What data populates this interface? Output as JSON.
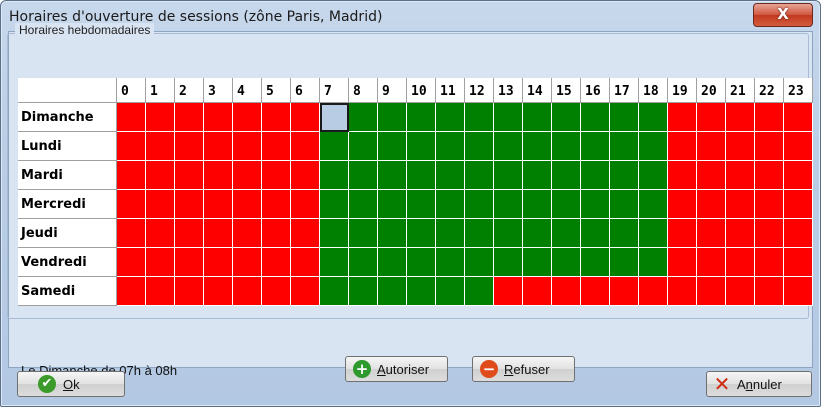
{
  "window": {
    "title": "Horaires d'ouverture de sessions (zône  Paris, Madrid)",
    "close_glyph": "X"
  },
  "group": {
    "label": "Horaires hebdomadaires"
  },
  "hours": [
    "0",
    "1",
    "2",
    "3",
    "4",
    "5",
    "6",
    "7",
    "8",
    "9",
    "10",
    "11",
    "12",
    "13",
    "14",
    "15",
    "16",
    "17",
    "18",
    "19",
    "20",
    "21",
    "22",
    "23"
  ],
  "days": [
    {
      "label": "Dimanche",
      "allowed_from": 7,
      "allowed_to": 19
    },
    {
      "label": "Lundi",
      "allowed_from": 7,
      "allowed_to": 19
    },
    {
      "label": "Mardi",
      "allowed_from": 7,
      "allowed_to": 19
    },
    {
      "label": "Mercredi",
      "allowed_from": 7,
      "allowed_to": 19
    },
    {
      "label": "Jeudi",
      "allowed_from": 7,
      "allowed_to": 19
    },
    {
      "label": "Vendredi",
      "allowed_from": 7,
      "allowed_to": 19
    },
    {
      "label": "Samedi",
      "allowed_from": 7,
      "allowed_to": 13
    }
  ],
  "selection": {
    "day": "Dimanche",
    "hour": 7
  },
  "colors": {
    "allowed": "#008000",
    "refused": "#ff0000",
    "selected": "#b8cce4"
  },
  "status_text": "Le Dimanche de 07h à 08h",
  "buttons": {
    "authorize": {
      "prefix": "",
      "mnemonic": "A",
      "rest": "utoriser",
      "icon": "plus-icon"
    },
    "refuse": {
      "prefix": "",
      "mnemonic": "R",
      "rest": "efuser",
      "icon": "minus-icon"
    },
    "ok": {
      "prefix": "",
      "mnemonic": "O",
      "rest": "k",
      "icon": "check-icon"
    },
    "cancel": {
      "prefix": "A",
      "mnemonic": "n",
      "rest": "nuler",
      "icon": "x-icon"
    }
  }
}
